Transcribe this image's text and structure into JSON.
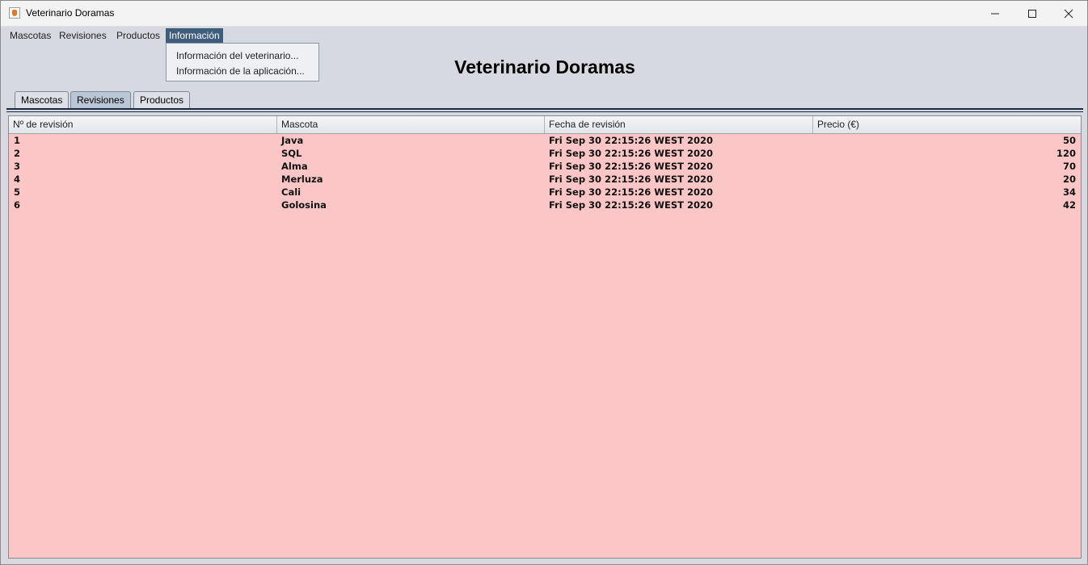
{
  "window": {
    "title": "Veterinario Doramas"
  },
  "menubar": {
    "items": [
      {
        "label": "Mascotas"
      },
      {
        "label": "Revisiones"
      },
      {
        "label": "Productos"
      },
      {
        "label": "Información"
      }
    ],
    "active_dropdown": {
      "items": [
        {
          "label": "Información del veterinario..."
        },
        {
          "label": "Información de la aplicación..."
        }
      ]
    }
  },
  "heading": "Veterinario Doramas",
  "tabs": [
    {
      "label": "Mascotas"
    },
    {
      "label": "Revisiones",
      "selected": true
    },
    {
      "label": "Productos"
    }
  ],
  "table": {
    "columns": [
      "Nº de revisión",
      "Mascota",
      "Fecha de revisión",
      "Precio (€)"
    ],
    "rows": [
      [
        "1",
        "Java",
        "Fri Sep 30 22:15:26 WEST 2020",
        "50"
      ],
      [
        "2",
        "SQL",
        "Fri Sep 30 22:15:26 WEST 2020",
        "120"
      ],
      [
        "3",
        "Alma",
        "Fri Sep 30 22:15:26 WEST 2020",
        "70"
      ],
      [
        "4",
        "Merluza",
        "Fri Sep 30 22:15:26 WEST 2020",
        "20"
      ],
      [
        "5",
        "Cali",
        "Fri Sep 30 22:15:26 WEST 2020",
        "34"
      ],
      [
        "6",
        "Golosina",
        "Fri Sep 30 22:15:26 WEST 2020",
        "42"
      ]
    ]
  },
  "colors": {
    "table_background": "#fdc6c6",
    "menu_highlight": "#3e5c7c",
    "selected_tab": "#b9c6d6"
  }
}
